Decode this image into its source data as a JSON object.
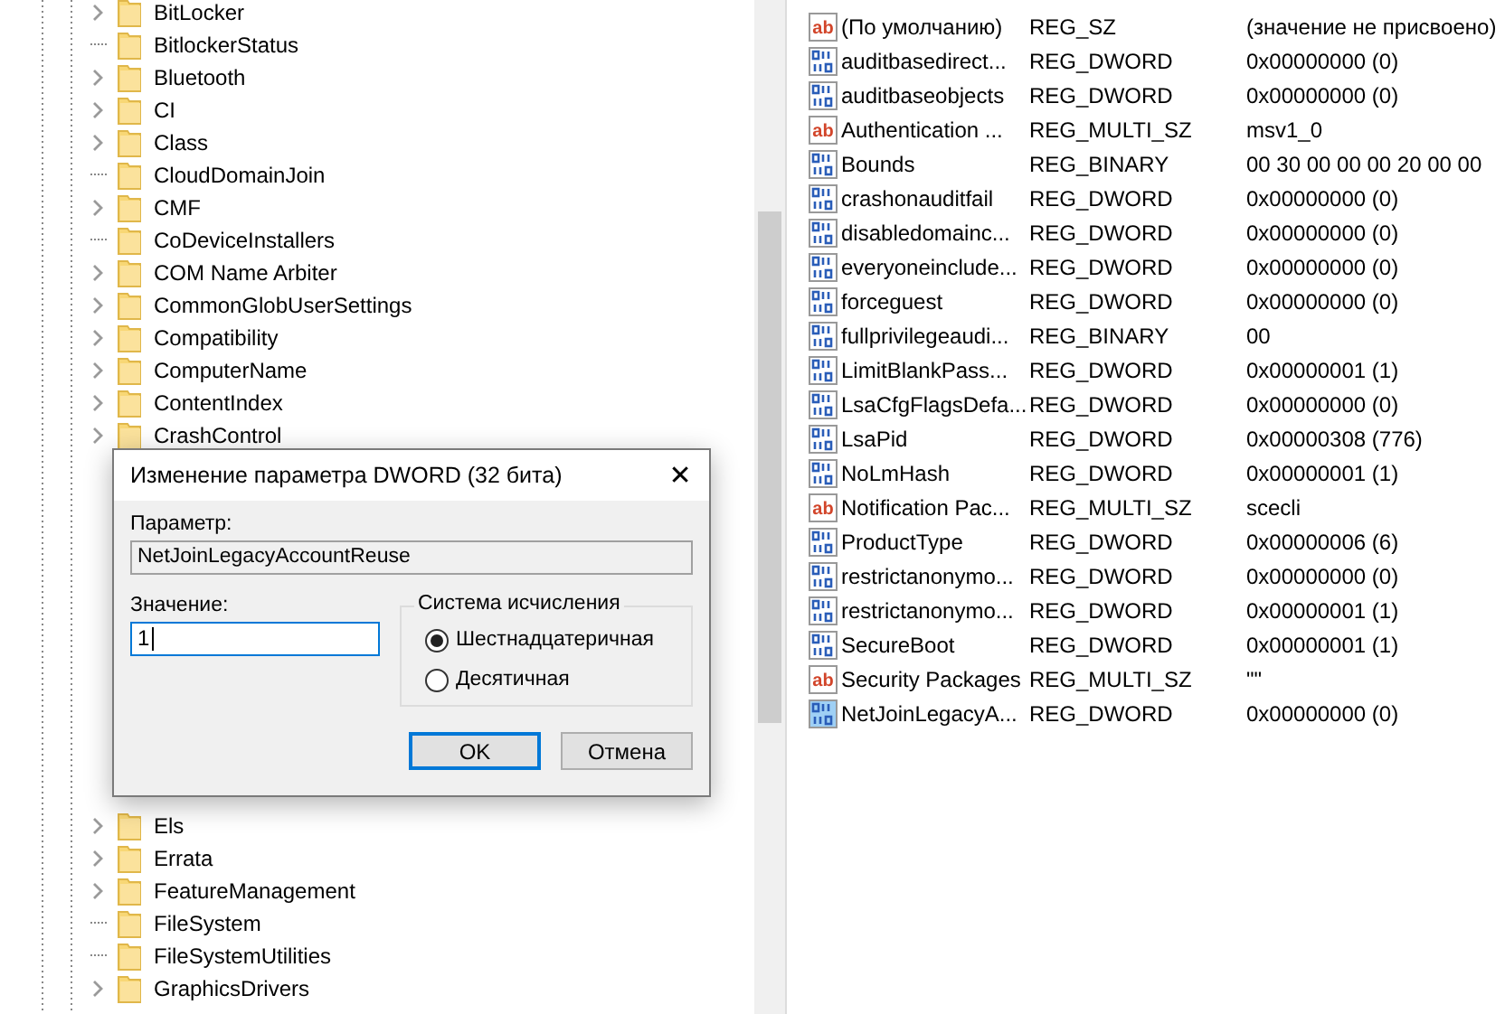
{
  "tree": {
    "items_before": [
      {
        "label": "BitLocker",
        "expandable": true
      },
      {
        "label": "BitlockerStatus",
        "expandable": false
      },
      {
        "label": "Bluetooth",
        "expandable": true
      },
      {
        "label": "CI",
        "expandable": true
      },
      {
        "label": "Class",
        "expandable": true
      },
      {
        "label": "CloudDomainJoin",
        "expandable": false
      },
      {
        "label": "CMF",
        "expandable": true
      },
      {
        "label": "CoDeviceInstallers",
        "expandable": false
      },
      {
        "label": "COM Name Arbiter",
        "expandable": true
      },
      {
        "label": "CommonGlobUserSettings",
        "expandable": true
      },
      {
        "label": "Compatibility",
        "expandable": true
      },
      {
        "label": "ComputerName",
        "expandable": true
      },
      {
        "label": "ContentIndex",
        "expandable": true
      },
      {
        "label": "CrashControl",
        "expandable": true
      }
    ],
    "items_after": [
      {
        "label": "Els",
        "expandable": true
      },
      {
        "label": "Errata",
        "expandable": true
      },
      {
        "label": "FeatureManagement",
        "expandable": true
      },
      {
        "label": "FileSystem",
        "expandable": false
      },
      {
        "label": "FileSystemUtilities",
        "expandable": false
      },
      {
        "label": "GraphicsDrivers",
        "expandable": true
      }
    ]
  },
  "values": [
    {
      "kind": "string",
      "icon": "ab",
      "name": "(По умолчанию)",
      "type": "REG_SZ",
      "data": "(значение не присвоено)",
      "selected": false
    },
    {
      "kind": "binary",
      "name": "auditbasedirect...",
      "type": "REG_DWORD",
      "data": "0x00000000 (0)",
      "selected": false
    },
    {
      "kind": "binary",
      "name": "auditbaseobjects",
      "type": "REG_DWORD",
      "data": "0x00000000 (0)",
      "selected": false
    },
    {
      "kind": "string",
      "icon": "ab",
      "name": "Authentication ...",
      "type": "REG_MULTI_SZ",
      "data": "msv1_0",
      "selected": false
    },
    {
      "kind": "binary",
      "name": "Bounds",
      "type": "REG_BINARY",
      "data": "00 30 00 00 00 20 00 00",
      "selected": false
    },
    {
      "kind": "binary",
      "name": "crashonauditfail",
      "type": "REG_DWORD",
      "data": "0x00000000 (0)",
      "selected": false
    },
    {
      "kind": "binary",
      "name": "disabledomainc...",
      "type": "REG_DWORD",
      "data": "0x00000000 (0)",
      "selected": false
    },
    {
      "kind": "binary",
      "name": "everyoneinclude...",
      "type": "REG_DWORD",
      "data": "0x00000000 (0)",
      "selected": false
    },
    {
      "kind": "binary",
      "name": "forceguest",
      "type": "REG_DWORD",
      "data": "0x00000000 (0)",
      "selected": false
    },
    {
      "kind": "binary",
      "name": "fullprivilegeaudi...",
      "type": "REG_BINARY",
      "data": "00",
      "selected": false
    },
    {
      "kind": "binary",
      "name": "LimitBlankPass...",
      "type": "REG_DWORD",
      "data": "0x00000001 (1)",
      "selected": false
    },
    {
      "kind": "binary",
      "name": "LsaCfgFlagsDefa...",
      "type": "REG_DWORD",
      "data": "0x00000000 (0)",
      "selected": false
    },
    {
      "kind": "binary",
      "name": "LsaPid",
      "type": "REG_DWORD",
      "data": "0x00000308 (776)",
      "selected": false
    },
    {
      "kind": "binary",
      "name": "NoLmHash",
      "type": "REG_DWORD",
      "data": "0x00000001 (1)",
      "selected": false
    },
    {
      "kind": "string",
      "icon": "ab",
      "name": "Notification Pac...",
      "type": "REG_MULTI_SZ",
      "data": "scecli",
      "selected": false
    },
    {
      "kind": "binary",
      "name": "ProductType",
      "type": "REG_DWORD",
      "data": "0x00000006 (6)",
      "selected": false
    },
    {
      "kind": "binary",
      "name": "restrictanonymo...",
      "type": "REG_DWORD",
      "data": "0x00000000 (0)",
      "selected": false
    },
    {
      "kind": "binary",
      "name": "restrictanonymo...",
      "type": "REG_DWORD",
      "data": "0x00000001 (1)",
      "selected": false
    },
    {
      "kind": "binary",
      "name": "SecureBoot",
      "type": "REG_DWORD",
      "data": "0x00000001 (1)",
      "selected": false
    },
    {
      "kind": "string",
      "icon": "ab",
      "name": "Security Packages",
      "type": "REG_MULTI_SZ",
      "data": "\"\"",
      "selected": false
    },
    {
      "kind": "binary",
      "name": "NetJoinLegacyA...",
      "type": "REG_DWORD",
      "data": "0x00000000 (0)",
      "selected": true
    }
  ],
  "dialog": {
    "title": "Изменение параметра DWORD (32 бита)",
    "close": "✕",
    "name_label": "Параметр:",
    "name_value": "NetJoinLegacyAccountReuse",
    "value_label": "Значение:",
    "value": "1",
    "base_group": "Система исчисления",
    "bases": [
      {
        "label": "Шестнадцатеричная",
        "selected": true
      },
      {
        "label": "Десятичная",
        "selected": false
      }
    ],
    "buttons": [
      {
        "label": "OK",
        "default": true
      },
      {
        "label": "Отмена",
        "default": false
      }
    ]
  }
}
